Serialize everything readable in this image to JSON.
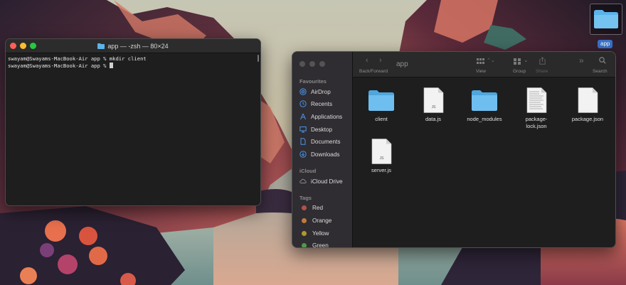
{
  "desktop": {
    "folder_icon": {
      "icon": "folder-icon",
      "label": "app"
    }
  },
  "terminal": {
    "title": "app — -zsh — 80×24",
    "lines": [
      "swayam@Swayams-MacBook-Air app % mkdir client",
      "swayam@Swayams-MacBook-Air app % "
    ]
  },
  "finder": {
    "title": "app",
    "toolbar": {
      "back_forward_label": "Back/Forward",
      "view_label": "View",
      "group_label": "Group",
      "share_label": "Share",
      "search_label": "Search"
    },
    "sidebar": {
      "favourites_heading": "Favourites",
      "favourites": [
        {
          "label": "AirDrop",
          "icon": "airdrop-icon"
        },
        {
          "label": "Recents",
          "icon": "clock-icon"
        },
        {
          "label": "Applications",
          "icon": "applications-icon"
        },
        {
          "label": "Desktop",
          "icon": "desktop-icon"
        },
        {
          "label": "Documents",
          "icon": "document-icon"
        },
        {
          "label": "Downloads",
          "icon": "download-icon"
        }
      ],
      "icloud_heading": "iCloud",
      "icloud": [
        {
          "label": "iCloud Drive",
          "icon": "cloud-icon"
        }
      ],
      "tags_heading": "Tags",
      "tags": [
        {
          "label": "Red",
          "color": "#b2514a"
        },
        {
          "label": "Orange",
          "color": "#c07a3a"
        },
        {
          "label": "Yellow",
          "color": "#b2972f"
        },
        {
          "label": "Green",
          "color": "#4c9a4c"
        }
      ]
    },
    "files": [
      {
        "name": "client",
        "type": "folder"
      },
      {
        "name": "data.js",
        "type": "js"
      },
      {
        "name": "node_modules",
        "type": "folder"
      },
      {
        "name": "package-\nlock.json",
        "type": "doc"
      },
      {
        "name": "package.json",
        "type": "json"
      },
      {
        "name": "server.js",
        "type": "js"
      }
    ]
  },
  "colors": {
    "folder_blue": "#5bb3ea",
    "selection_blue": "#3a72c8"
  }
}
